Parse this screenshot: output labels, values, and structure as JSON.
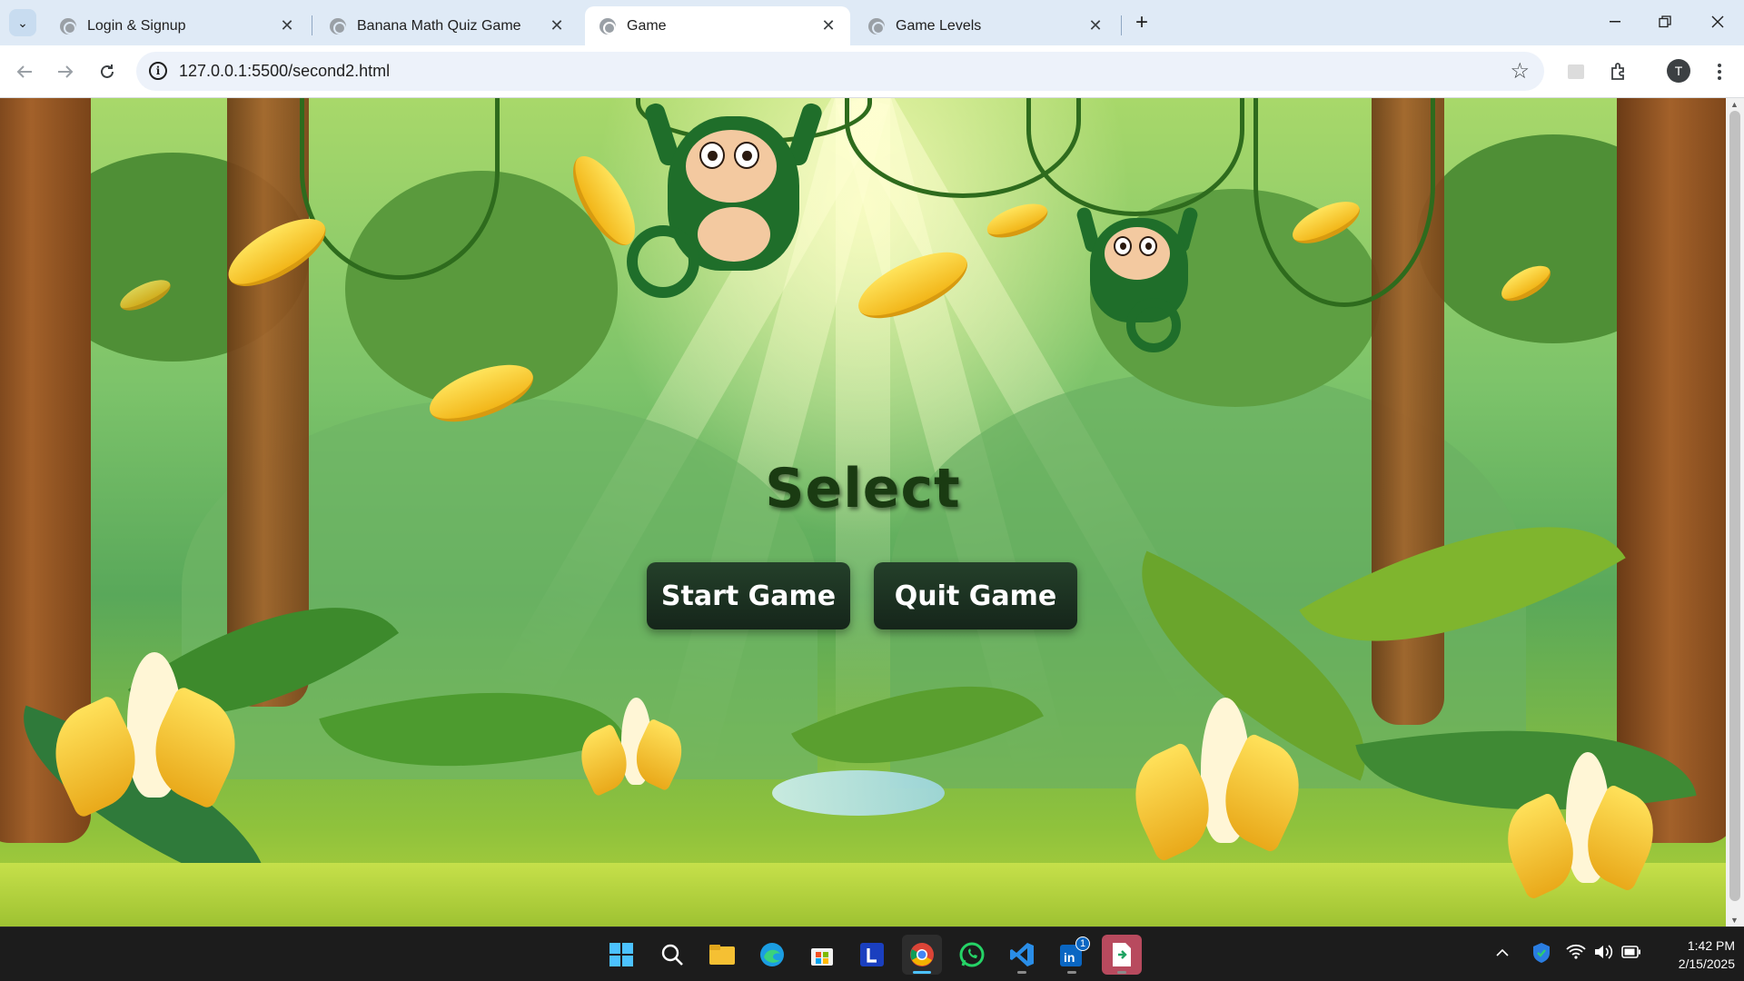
{
  "browser": {
    "tabs": [
      {
        "title": "Login & Signup",
        "active": false
      },
      {
        "title": "Banana Math Quiz Game",
        "active": false
      },
      {
        "title": "Game",
        "active": true
      },
      {
        "title": "Game Levels",
        "active": false
      }
    ],
    "close_glyph": "✕",
    "new_tab_glyph": "+",
    "url": "127.0.0.1:5500/second2.html",
    "info_glyph": "i",
    "profile_initial": "T"
  },
  "page": {
    "heading": "Select",
    "buttons": {
      "start": "Start Game",
      "quit": "Quit Game"
    },
    "colors": {
      "button_bg": "#1b2e1f",
      "button_text": "#ffffff",
      "heading": "#1a3b12"
    }
  },
  "taskbar": {
    "apps": [
      "windows-start",
      "search",
      "file-explorer",
      "edge",
      "microsoft-store",
      "l-app",
      "chrome",
      "whatsapp",
      "vscode",
      "linkedin",
      "notepad-app"
    ],
    "linkedin_badge": "1",
    "time": "1:42 PM",
    "date": "2/15/2025"
  }
}
